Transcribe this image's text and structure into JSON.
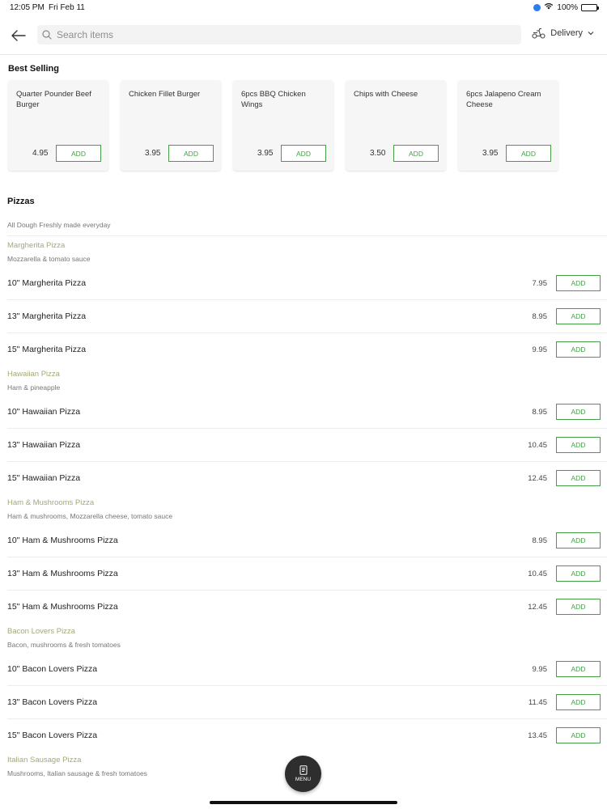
{
  "status_bar": {
    "time": "12:05 PM",
    "date": "Fri Feb 11",
    "battery": "100%"
  },
  "header": {
    "search_placeholder": "Search items",
    "delivery_label": "Delivery"
  },
  "best_selling": {
    "title": "Best Selling",
    "add_label": "ADD",
    "items": [
      {
        "name": "Quarter Pounder Beef Burger",
        "price": "4.95"
      },
      {
        "name": "Chicken Fillet Burger",
        "price": "3.95"
      },
      {
        "name": "6pcs BBQ Chicken Wings",
        "price": "3.95"
      },
      {
        "name": "Chips with Cheese",
        "price": "3.50"
      },
      {
        "name": "6pcs Jalapeno Cream Cheese",
        "price": "3.95"
      }
    ]
  },
  "pizzas": {
    "title": "Pizzas",
    "description": "All Dough Freshly made everyday",
    "add_label": "ADD",
    "groups": [
      {
        "name": "Margherita Pizza",
        "description": "Mozzarella & tomato sauce",
        "items": [
          {
            "name": "10\" Margherita Pizza",
            "price": "7.95"
          },
          {
            "name": "13\" Margherita Pizza",
            "price": "8.95"
          },
          {
            "name": "15\" Margherita Pizza",
            "price": "9.95"
          }
        ]
      },
      {
        "name": "Hawaiian Pizza",
        "description": "Ham & pineapple",
        "items": [
          {
            "name": "10\" Hawaiian Pizza",
            "price": "8.95"
          },
          {
            "name": "13\" Hawaiian Pizza",
            "price": "10.45"
          },
          {
            "name": "15\" Hawaiian Pizza",
            "price": "12.45"
          }
        ]
      },
      {
        "name": "Ham & Mushrooms Pizza",
        "description": "Ham & mushrooms, Mozzarella cheese, tomato sauce",
        "items": [
          {
            "name": "10\" Ham & Mushrooms Pizza",
            "price": "8.95"
          },
          {
            "name": "13\" Ham & Mushrooms Pizza",
            "price": "10.45"
          },
          {
            "name": "15\" Ham & Mushrooms Pizza",
            "price": "12.45"
          }
        ]
      },
      {
        "name": "Bacon Lovers Pizza",
        "description": "Bacon, mushrooms & fresh tomatoes",
        "items": [
          {
            "name": "10\" Bacon Lovers Pizza",
            "price": "9.95"
          },
          {
            "name": "13\" Bacon Lovers Pizza",
            "price": "11.45"
          },
          {
            "name": "15\" Bacon Lovers Pizza",
            "price": "13.45"
          }
        ]
      },
      {
        "name": "Italian Sausage Pizza",
        "description": "Mushrooms, Italian sausage & fresh tomatoes",
        "items": []
      }
    ]
  },
  "menu_button": {
    "label": "MENU"
  },
  "colors": {
    "accent_green": "#43a047",
    "group_title": "#a5a77a",
    "fab_bg": "#2e2e2e"
  }
}
